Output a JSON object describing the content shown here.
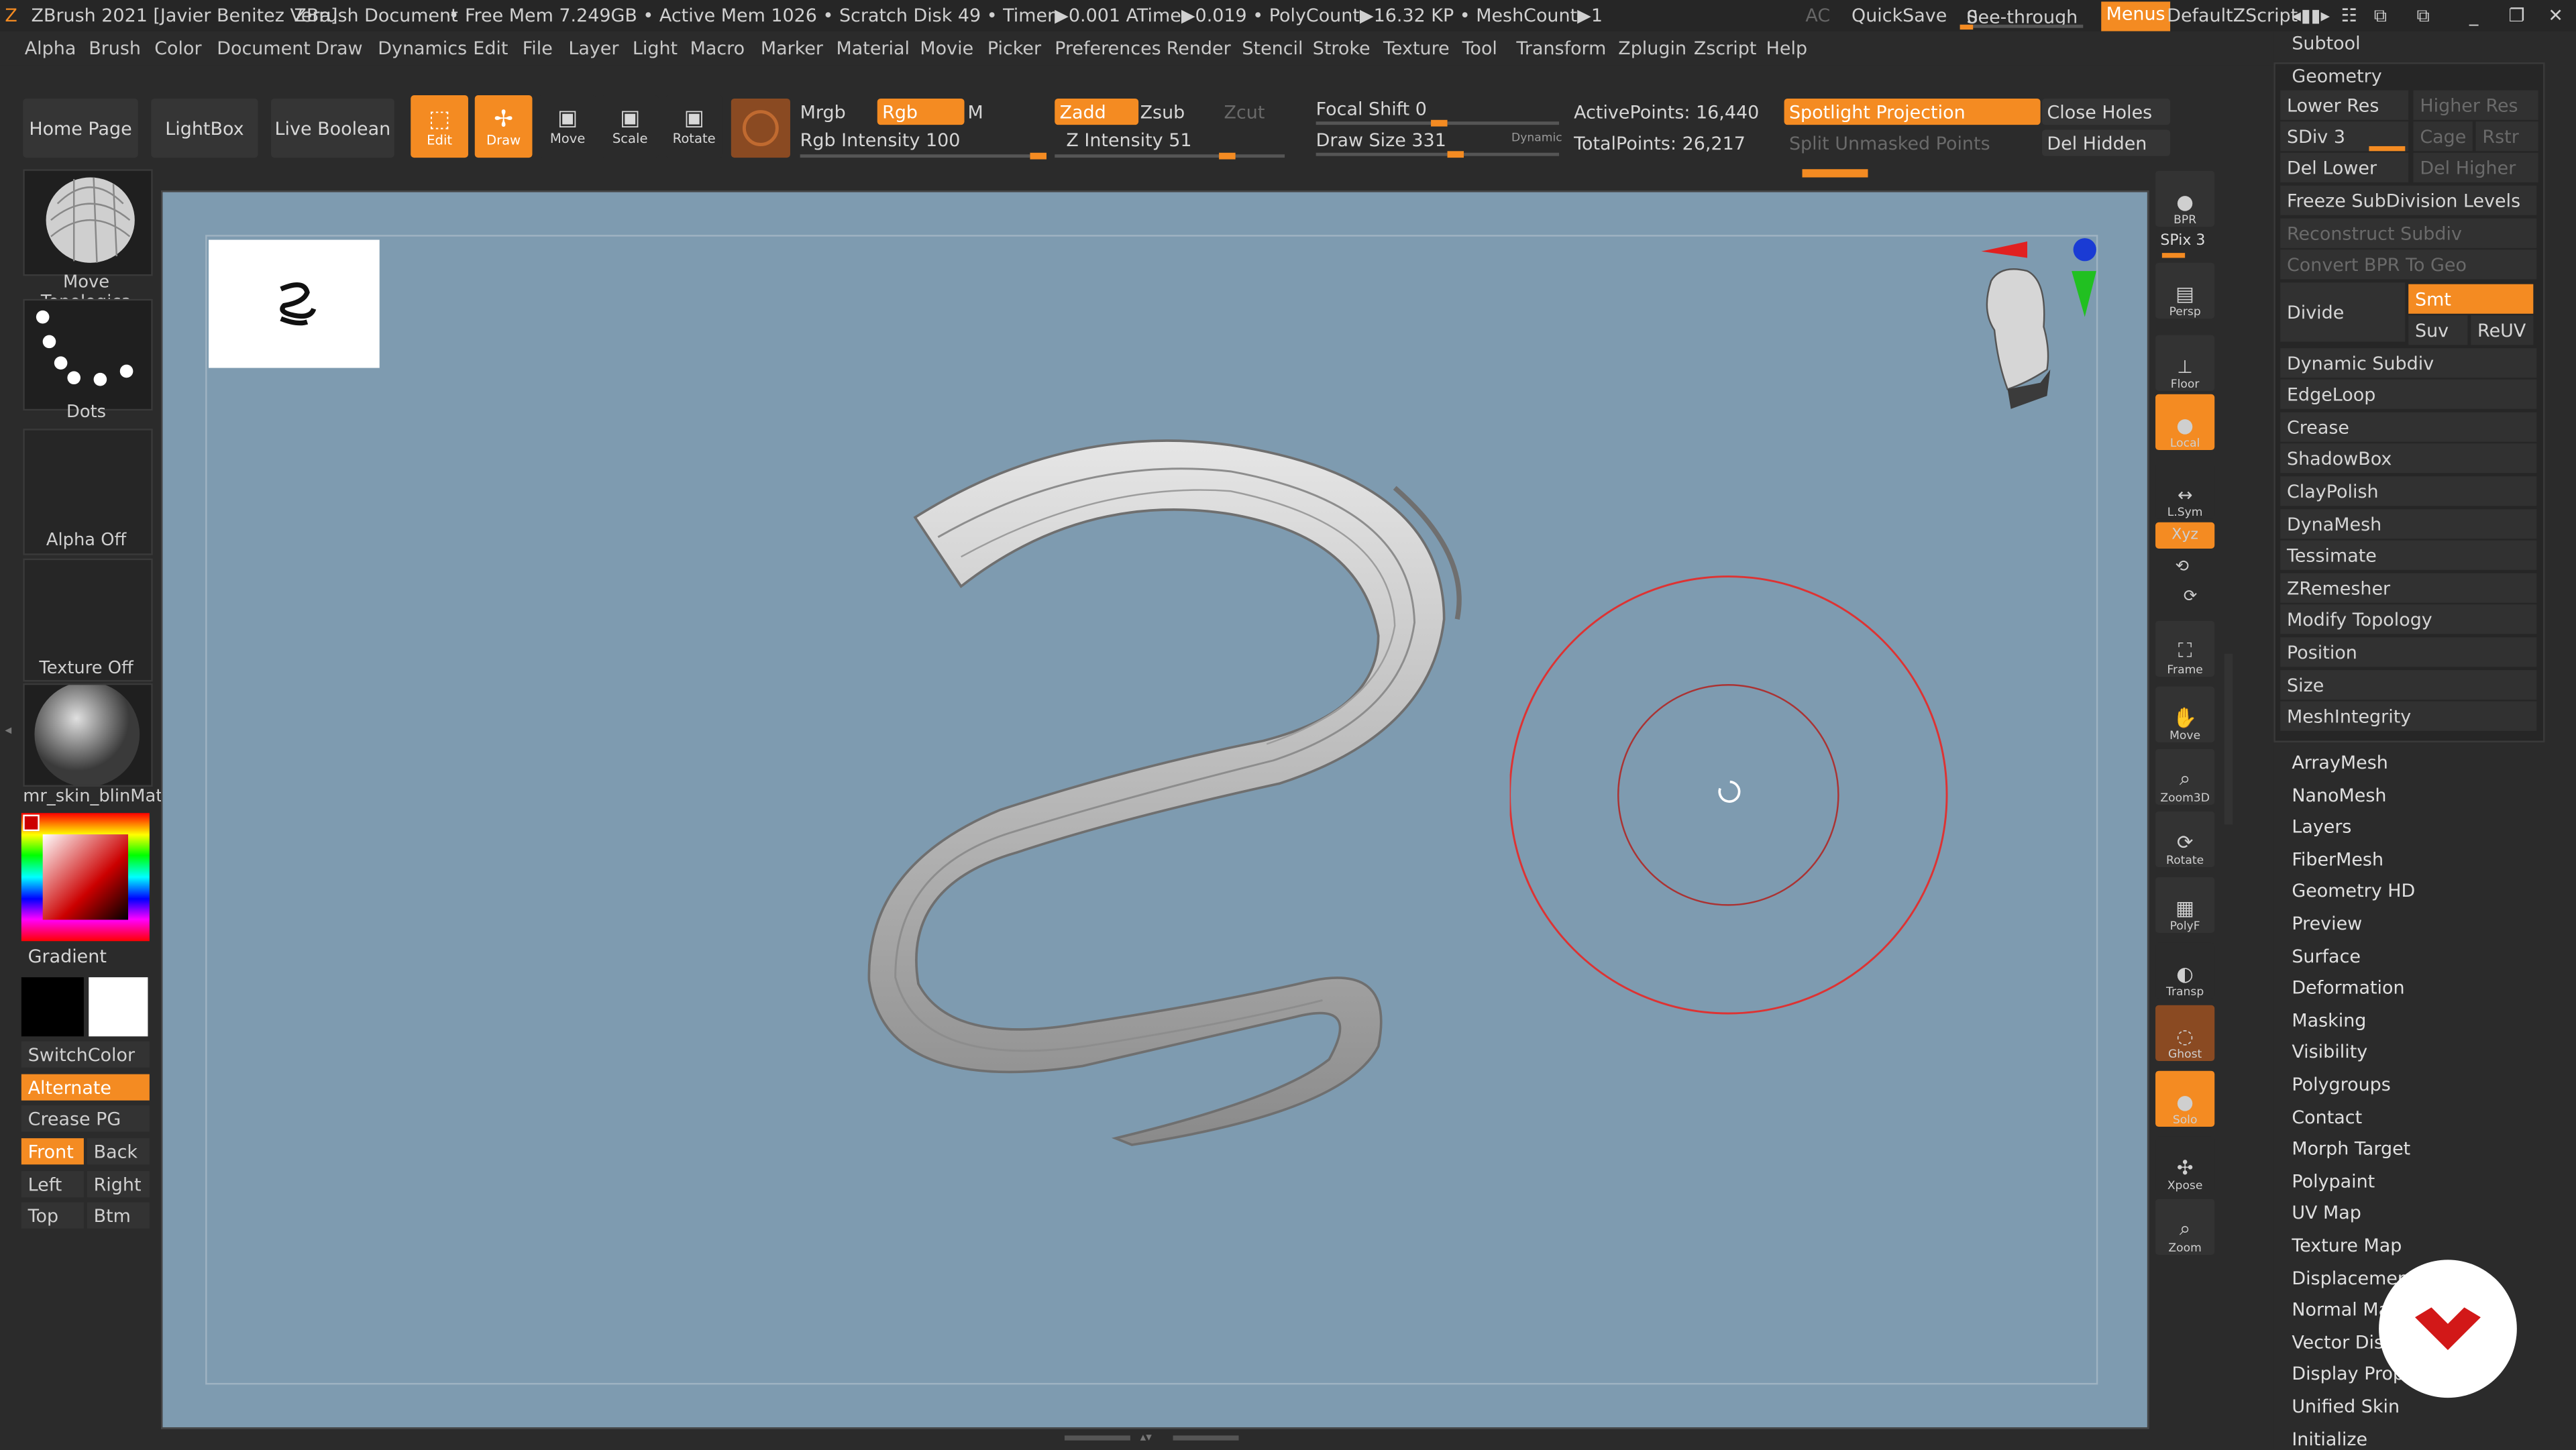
{
  "titlebar": {
    "app": "ZBrush 2021 [Javier Benitez Vera]",
    "document": "ZBrush Document",
    "stats": "• Free Mem 7.249GB • Active Mem 1026 • Scratch Disk 49 • Timer▶0.001 ATime▶0.019 • PolyCount▶16.32 KP • MeshCount▶1",
    "ac": "AC",
    "quicksave": "QuickSave",
    "seethrough": "See-through",
    "seethrough_value": "0",
    "menus": "Menus",
    "script": "DefaultZScript"
  },
  "menu": [
    "Alpha",
    "Brush",
    "Color",
    "Document",
    "Draw",
    "Dynamics",
    "Edit",
    "File",
    "Layer",
    "Light",
    "Macro",
    "Marker",
    "Material",
    "Movie",
    "Picker",
    "Preferences",
    "Render",
    "Stencil",
    "Stroke",
    "Texture",
    "Tool",
    "Transform",
    "Zplugin",
    "Zscript",
    "Help"
  ],
  "shelf": {
    "home": "Home Page",
    "lightbox": "LightBox",
    "liveboolean": "Live Boolean",
    "edit": "Edit",
    "draw": "Draw",
    "move": "Move",
    "scale": "Scale",
    "rotate": "Rotate",
    "mrgb": "Mrgb",
    "rgb": "Rgb",
    "m": "M",
    "rgb_intensity": "Rgb Intensity 100",
    "zadd": "Zadd",
    "zsub": "Zsub",
    "zcut": "Zcut",
    "z_intensity": "Z Intensity 51",
    "focal_shift": "Focal Shift 0",
    "draw_size": "Draw Size 331",
    "dynamic": "Dynamic",
    "active_points": "ActivePoints: 16,440",
    "total_points": "TotalPoints: 26,217",
    "spotlight": "Spotlight Projection",
    "split_unmasked": "Split Unmasked Points",
    "close_holes": "Close Holes",
    "del_hidden": "Del Hidden"
  },
  "left": {
    "brush": "Move Topologica",
    "stroke": "Dots",
    "alpha": "Alpha Off",
    "texture": "Texture Off",
    "material": "mr_skin_blinMate",
    "gradient": "Gradient",
    "switchcolor": "SwitchColor",
    "alternate": "Alternate",
    "creasepg": "Crease PG",
    "front": "Front",
    "back": "Back",
    "left": "Left",
    "right": "Right",
    "top": "Top",
    "btm": "Btm"
  },
  "rightshelf": [
    "BPR",
    "SPix 3",
    "Persp",
    "Floor",
    "Local",
    "L.Sym",
    "Xyz",
    "Frame",
    "Move",
    "Zoom3D",
    "Rotate",
    "PolyF",
    "Transp",
    "Ghost",
    "Solo",
    "Xpose",
    "Zoom"
  ],
  "tray": {
    "subtool": "Subtool",
    "geometry": "Geometry",
    "lower_res": "Lower Res",
    "higher_res": "Higher Res",
    "sdiv": "SDiv 3",
    "cage": "Cage",
    "rstr": "Rstr",
    "del_lower": "Del Lower",
    "del_higher": "Del Higher",
    "freeze": "Freeze SubDivision Levels",
    "reconstruct": "Reconstruct Subdiv",
    "convert_bpr": "Convert BPR To Geo",
    "divide": "Divide",
    "smt": "Smt",
    "suv": "Suv",
    "reuv": "ReUV",
    "geo_items": [
      "Dynamic Subdiv",
      "EdgeLoop",
      "Crease",
      "ShadowBox",
      "ClayPolish",
      "DynaMesh",
      "Tessimate",
      "ZRemesher",
      "Modify Topology",
      "Position",
      "Size",
      "MeshIntegrity"
    ],
    "sub_items": [
      "ArrayMesh",
      "NanoMesh",
      "Layers",
      "FiberMesh",
      "Geometry HD",
      "Preview",
      "Surface",
      "Deformation",
      "Masking",
      "Visibility",
      "Polygroups",
      "Contact",
      "Morph Target",
      "Polypaint",
      "UV Map",
      "Texture Map",
      "Displacement Map",
      "Normal Map",
      "Vector Displacement",
      "Display Properties",
      "Unified Skin",
      "Initialize"
    ]
  },
  "colors": {
    "accent": "#f48b22",
    "canvas": "#7e9bb0",
    "panel": "#2b2b2b"
  }
}
